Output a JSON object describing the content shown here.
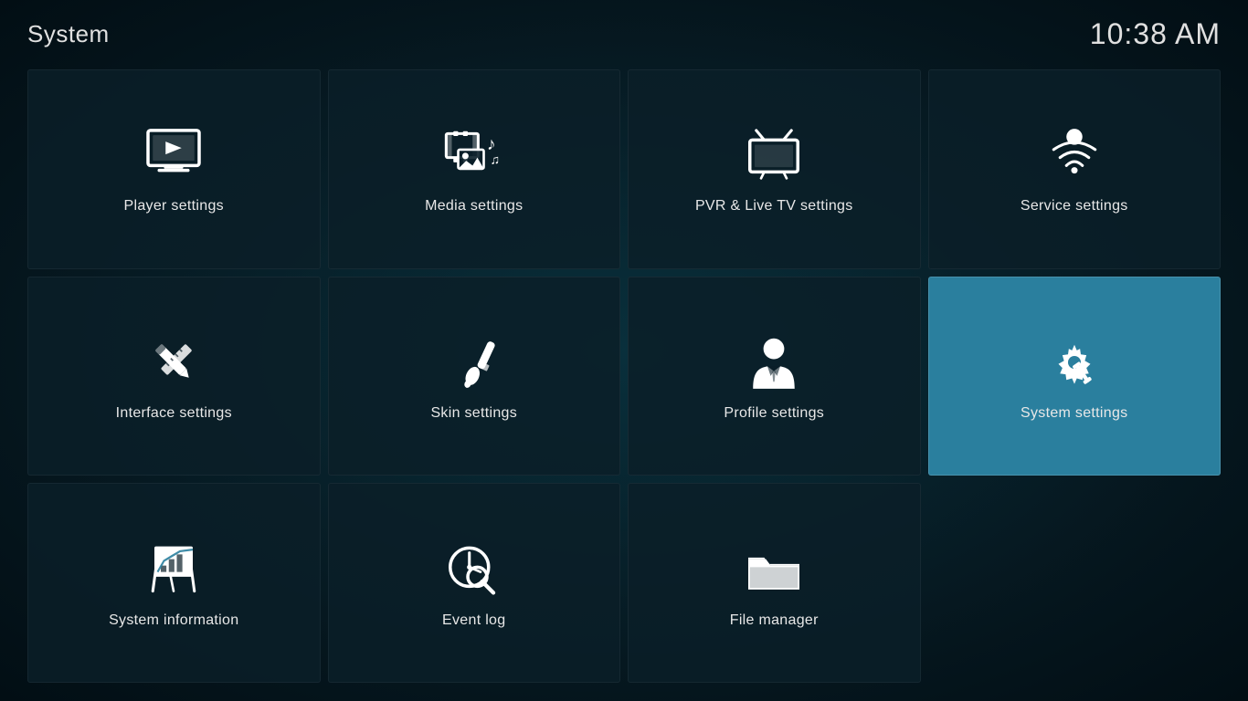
{
  "header": {
    "title": "System",
    "clock": "10:38 AM"
  },
  "tiles": [
    {
      "id": "player-settings",
      "label": "Player settings",
      "icon": "player",
      "active": false
    },
    {
      "id": "media-settings",
      "label": "Media settings",
      "icon": "media",
      "active": false
    },
    {
      "id": "pvr-settings",
      "label": "PVR & Live TV settings",
      "icon": "pvr",
      "active": false
    },
    {
      "id": "service-settings",
      "label": "Service settings",
      "icon": "service",
      "active": false
    },
    {
      "id": "interface-settings",
      "label": "Interface settings",
      "icon": "interface",
      "active": false
    },
    {
      "id": "skin-settings",
      "label": "Skin settings",
      "icon": "skin",
      "active": false
    },
    {
      "id": "profile-settings",
      "label": "Profile settings",
      "icon": "profile",
      "active": false
    },
    {
      "id": "system-settings",
      "label": "System settings",
      "icon": "system",
      "active": true
    },
    {
      "id": "system-information",
      "label": "System information",
      "icon": "sysinfo",
      "active": false
    },
    {
      "id": "event-log",
      "label": "Event log",
      "icon": "eventlog",
      "active": false
    },
    {
      "id": "file-manager",
      "label": "File manager",
      "icon": "filemanager",
      "active": false
    }
  ]
}
